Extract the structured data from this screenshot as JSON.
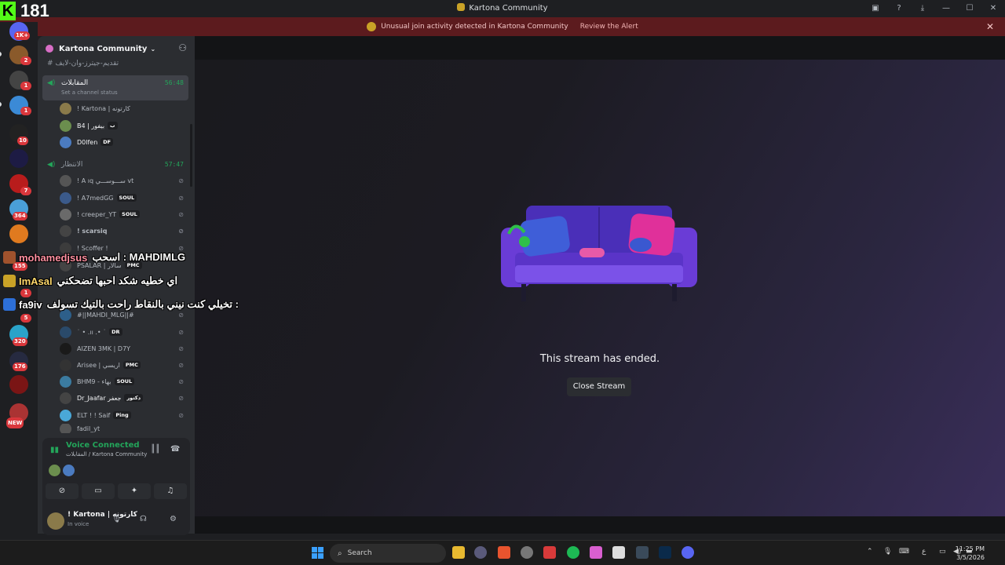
{
  "window": {
    "title": "Kartona Community",
    "controls": [
      "minimize",
      "maximize",
      "close"
    ]
  },
  "kick_overlay": {
    "logo": "K",
    "viewer_count": "181"
  },
  "alert_banner": {
    "message": "Unusual join activity detected in Kartona Community",
    "action": "Review the Alert"
  },
  "server_rail": {
    "badges": [
      "1K+",
      "2",
      "1",
      "1",
      "10",
      "7",
      "364",
      "155",
      "1",
      "5",
      "320",
      "176",
      "NEW"
    ]
  },
  "server": {
    "name": "Kartona Community",
    "text_channel": "تقديم-جيترز-وان-لايف",
    "voice_channels": [
      {
        "name": "المقابلات",
        "time": "56:48",
        "status": "Set a channel status",
        "members": [
          {
            "name": "! Kartona | كارتونه",
            "tag": ""
          },
          {
            "name": "B4 | بيفور",
            "tag": "ب"
          },
          {
            "name": "D0lfen",
            "tag": "DF"
          }
        ]
      },
      {
        "name": "الانتظار",
        "time": "57:47",
        "members": [
          {
            "name": "! A ıq ســـوســـي vt",
            "tag": ""
          },
          {
            "name": "! A7medGG",
            "tag": "SOUL"
          },
          {
            "name": "! creeper_YT",
            "tag": "SOUL"
          },
          {
            "name": "! scarsiq",
            "tag": ""
          },
          {
            "name": "! Scoffer !",
            "tag": ""
          },
          {
            "name": "PSALAR | سالار",
            "tag": "PMC"
          },
          {
            "name": "#||MAHDI_MLG||#",
            "tag": ""
          },
          {
            "name": "˙ • .ıı .• ˙",
            "tag": "DR"
          },
          {
            "name": "AIZEN 3MK | D7Y",
            "tag": ""
          },
          {
            "name": "Arisee | اريسي",
            "tag": "PMC"
          },
          {
            "name": "BHM9 - بهاء",
            "tag": "SOUL"
          },
          {
            "name": "Dr_Jaafar جعفر",
            "tag": "دكتور"
          },
          {
            "name": "ELT ! ! Saif",
            "tag": "Ping"
          },
          {
            "name": "fadil_yt",
            "tag": ""
          }
        ]
      }
    ]
  },
  "chat_overlay": [
    {
      "user": "mohamedjsus",
      "text": "اسحب : MAHDIMLG"
    },
    {
      "user": "ImAsal",
      "text": "اي خطيه شكد احبها تضحكني"
    },
    {
      "user": "fa9iv",
      "text": "تخيلي كنت نيني بالنقاط راحت بالتيك تسولف :"
    }
  ],
  "voice_panel": {
    "status": "Voice Connected",
    "channel": "المقابلات / Kartona Community",
    "buttons": [
      "camera-off-icon",
      "screen-share-icon",
      "activities-icon",
      "soundboard-icon"
    ]
  },
  "user": {
    "name": "! Kartona | كارتونه",
    "status": "In voice"
  },
  "stream": {
    "message": "This stream has ended.",
    "close_label": "Close Stream"
  },
  "taskbar": {
    "search_placeholder": "Search",
    "time": "11:25 PM",
    "date": "3/5/2026",
    "lang": "ع"
  },
  "colors": {
    "discord_green": "#23a55a",
    "alert_bg": "#5c1b1e",
    "kick_green": "#53fc18",
    "couch_purple": "#6a3cd6"
  }
}
